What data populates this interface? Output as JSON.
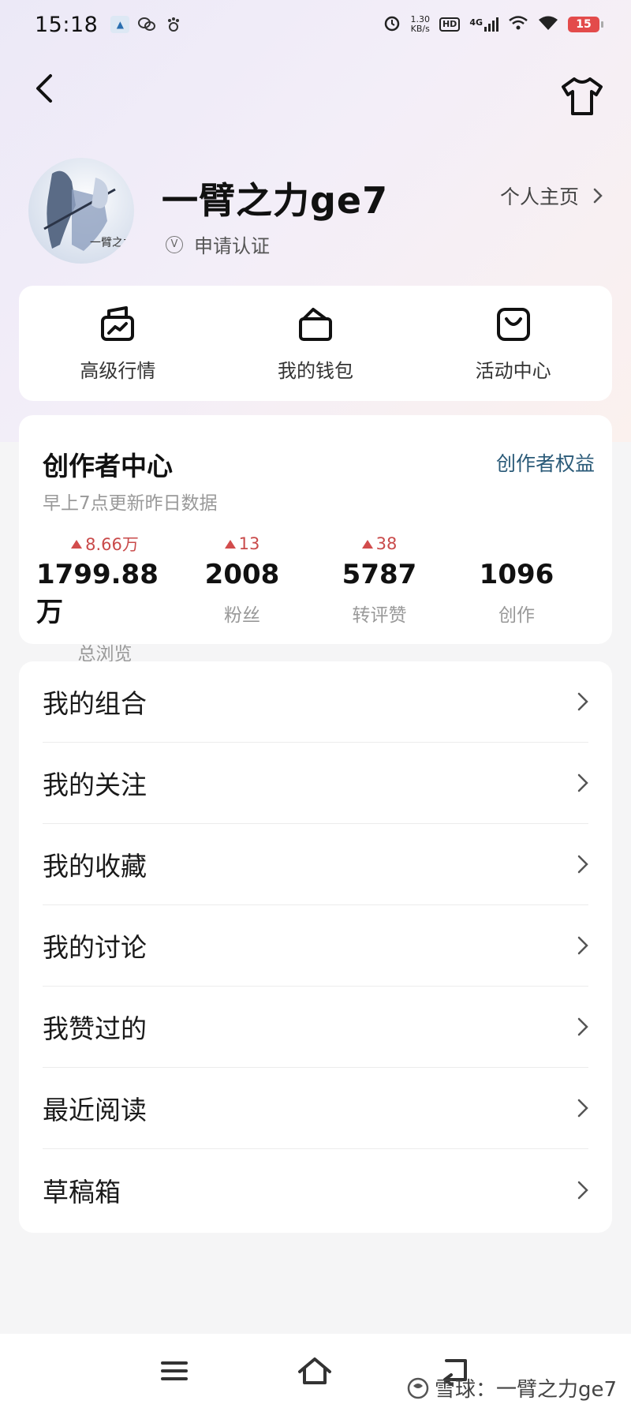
{
  "status_bar": {
    "time": "15:18",
    "net_speed_value": "1.30",
    "net_speed_unit": "KB/s",
    "hd": "HD",
    "network": "4G",
    "battery": "15"
  },
  "header": {
    "back_icon": "chevron-left-icon",
    "skin_icon": "tshirt-icon"
  },
  "profile": {
    "username": "一臂之力ge7",
    "verify_icon_text": "V",
    "verify_label": "申请认证",
    "homepage_label": "个人主页",
    "avatar_text": "一臂之力"
  },
  "quick_actions": [
    {
      "label": "高级行情",
      "icon": "market-chart-icon"
    },
    {
      "label": "我的钱包",
      "icon": "wallet-icon"
    },
    {
      "label": "活动中心",
      "icon": "activity-bag-icon"
    }
  ],
  "creator": {
    "title": "创作者中心",
    "link": "创作者权益",
    "subtitle": "早上7点更新昨日数据",
    "stats": [
      {
        "delta": "8.66万",
        "value": "1799.88万",
        "label": "总浏览"
      },
      {
        "delta": "13",
        "value": "2008",
        "label": "粉丝"
      },
      {
        "delta": "38",
        "value": "5787",
        "label": "转评赞"
      },
      {
        "delta": "",
        "value": "1096",
        "label": "创作"
      }
    ]
  },
  "menu": [
    {
      "label": "我的组合"
    },
    {
      "label": "我的关注"
    },
    {
      "label": "我的收藏"
    },
    {
      "label": "我的讨论"
    },
    {
      "label": "我赞过的"
    },
    {
      "label": "最近阅读"
    },
    {
      "label": "草稿箱"
    }
  ],
  "watermark": "雪球：一臂之力ge7",
  "colors": {
    "accent_link": "#2a5a78",
    "delta_up": "#c94a4a",
    "battery": "#e34b4b"
  }
}
